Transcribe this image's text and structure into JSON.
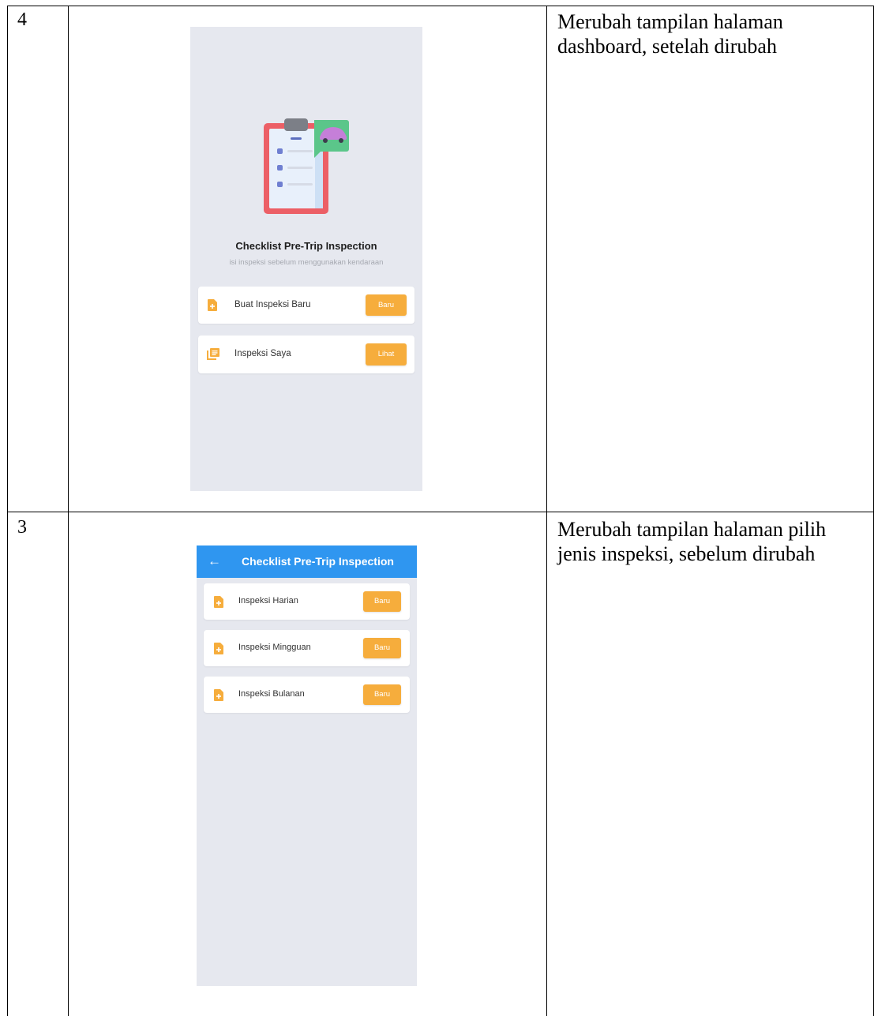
{
  "rows": [
    {
      "number": "4",
      "description": "Merubah tampilan halaman dashboard, setelah dirubah",
      "screen": {
        "title": "Checklist Pre-Trip Inspection",
        "subtitle": "isi inspeksi sebelum menggunakan kendaraan",
        "items": [
          {
            "label": "Buat Inspeksi Baru",
            "button": "Baru",
            "icon": "add-document-icon"
          },
          {
            "label": "Inspeksi Saya",
            "button": "Lihat",
            "icon": "document-list-icon"
          }
        ]
      }
    },
    {
      "number": "3",
      "description": "Merubah tampilan halaman pilih jenis inspeksi, sebelum dirubah",
      "screen": {
        "back_icon": "←",
        "title": "Checklist Pre-Trip Inspection",
        "items": [
          {
            "label": "Inspeksi Harian",
            "button": "Baru",
            "icon": "add-document-icon"
          },
          {
            "label": "Inspeksi Mingguan",
            "button": "Baru",
            "icon": "add-document-icon"
          },
          {
            "label": "Inspeksi Bulanan",
            "button": "Baru",
            "icon": "add-document-icon"
          }
        ]
      }
    }
  ],
  "colors": {
    "phone_bg": "#e6e8ef",
    "accent_orange": "#f6ad3c",
    "appbar_blue": "#2f96f0"
  }
}
